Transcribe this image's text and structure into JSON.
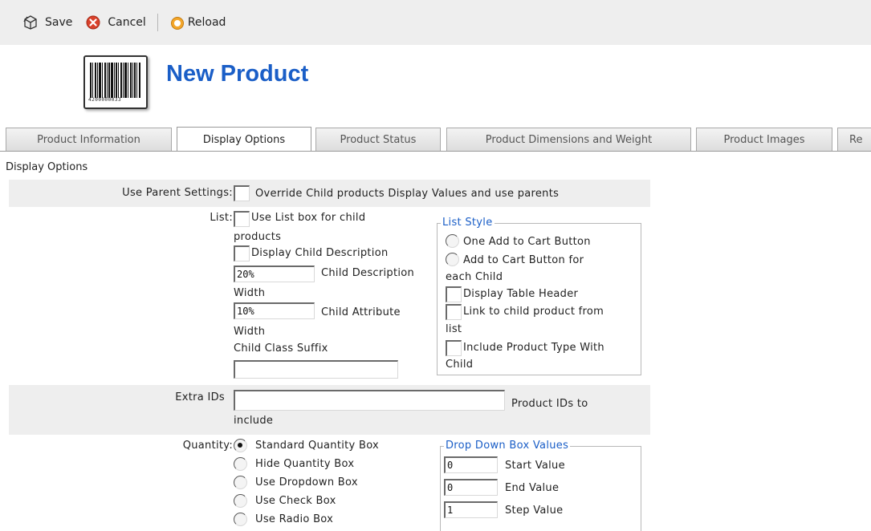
{
  "toolbar": {
    "save_label": "Save",
    "cancel_label": "Cancel",
    "reload_label": "Reload"
  },
  "header": {
    "title": "New Product",
    "barcode_text": "4200000033"
  },
  "tabs": [
    {
      "label": "Product Information",
      "active": false
    },
    {
      "label": "Display Options",
      "active": true
    },
    {
      "label": "Product Status",
      "active": false
    },
    {
      "label": "Product Dimensions and Weight",
      "active": false
    },
    {
      "label": "Product Images",
      "active": false
    },
    {
      "label": "Re",
      "active": false
    }
  ],
  "section_title": "Display Options",
  "use_parent": {
    "label": "Use Parent Settings:",
    "checkbox_label": "Override Child products Display Values and use parents",
    "checked": false
  },
  "list": {
    "label": "List:",
    "use_listbox_a": "Use List box for child",
    "use_listbox_b": "products",
    "display_child_desc": "Display Child Description",
    "child_desc_width_value": "20%",
    "child_desc_width_label_a": "Child Description",
    "child_desc_width_label_b": "Width",
    "child_attr_width_value": "10%",
    "child_attr_width_label_a": "Child Attribute",
    "child_attr_width_label_b": "Width",
    "child_class_suffix_label": "Child Class Suffix",
    "child_class_suffix_value": ""
  },
  "list_style": {
    "legend": "List Style",
    "one_add_to_cart": "One Add to Cart Button",
    "add_each_a": "Add to Cart Button for",
    "add_each_b": "each Child",
    "display_table_header": "Display Table Header",
    "link_child_a": "Link to child product from",
    "link_child_b": "list",
    "include_type_a": "Include Product Type With",
    "include_type_b": "Child"
  },
  "extra_ids": {
    "label": "Extra IDs",
    "value": "",
    "hint_a": "Product IDs to",
    "hint_b": "include"
  },
  "quantity": {
    "label": "Quantity:",
    "options": [
      {
        "label": "Standard Quantity Box",
        "selected": true
      },
      {
        "label": "Hide Quantity Box",
        "selected": false
      },
      {
        "label": "Use Dropdown Box",
        "selected": false
      },
      {
        "label": "Use Check Box",
        "selected": false
      },
      {
        "label": "Use Radio Box",
        "selected": false
      }
    ]
  },
  "dropdown_values": {
    "legend": "Drop Down Box Values",
    "start_value": "0",
    "start_label": "Start Value",
    "end_value": "0",
    "end_label": "End Value",
    "step_value": "1",
    "step_label": "Step Value"
  },
  "colors": {
    "title_blue": "#1a5ec7",
    "toolbar_bg": "#eeeeee",
    "row_gray": "#eeeeee"
  },
  "icons": {
    "save": "save-icon",
    "cancel": "cancel-icon",
    "reload": "reload-icon",
    "barcode": "barcode-icon"
  }
}
